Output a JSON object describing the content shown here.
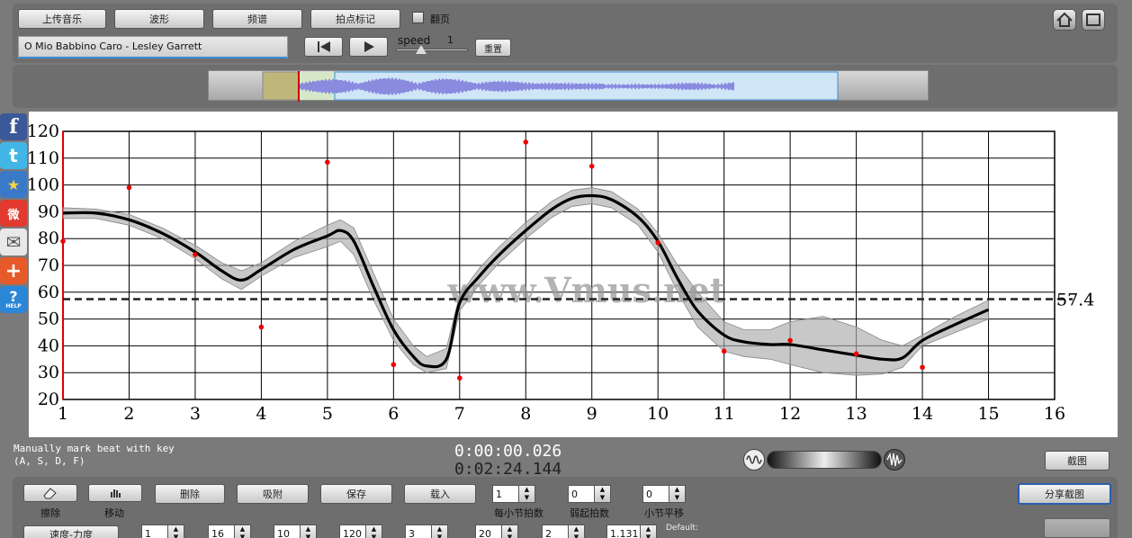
{
  "toolbar": {
    "upload": "上传音乐",
    "waveform": "波形",
    "spectrum": "频谱",
    "beat_mark": "拍点标记",
    "page_flip": "翻页",
    "song_title": "O Mio Babbino Caro - Lesley Garrett",
    "speed_label": "speed",
    "speed_value": "1",
    "reset": "重置"
  },
  "chart_data": {
    "type": "line",
    "x_ticks": [
      "1",
      "2",
      "3",
      "4",
      "5",
      "6",
      "7",
      "8",
      "9",
      "10",
      "11",
      "12",
      "13",
      "14",
      "15",
      "16"
    ],
    "y_ticks": [
      "20",
      "30",
      "40",
      "50",
      "60",
      "70",
      "80",
      "90",
      "100",
      "110",
      "120"
    ],
    "xlim": [
      1,
      16
    ],
    "ylim": [
      15,
      120
    ],
    "reference_line": {
      "value": 57.4,
      "label": "57.4"
    },
    "watermark": "www.Vmus.net",
    "smooth_curve": [
      [
        1,
        89.5
      ],
      [
        1.5,
        89.5
      ],
      [
        2,
        87
      ],
      [
        2.5,
        82
      ],
      [
        3,
        75
      ],
      [
        3.4,
        68
      ],
      [
        3.7,
        64.5
      ],
      [
        4,
        68.5
      ],
      [
        4.5,
        76
      ],
      [
        5,
        81
      ],
      [
        5.2,
        83
      ],
      [
        5.4,
        79
      ],
      [
        5.7,
        62
      ],
      [
        6,
        46
      ],
      [
        6.3,
        36
      ],
      [
        6.5,
        32.5
      ],
      [
        6.8,
        35
      ],
      [
        7,
        56
      ],
      [
        7.3,
        66
      ],
      [
        7.6,
        74
      ],
      [
        8,
        83
      ],
      [
        8.4,
        91
      ],
      [
        8.7,
        95
      ],
      [
        9,
        96
      ],
      [
        9.3,
        94.5
      ],
      [
        9.7,
        88
      ],
      [
        10,
        79
      ],
      [
        10.3,
        65
      ],
      [
        10.6,
        53
      ],
      [
        11,
        44
      ],
      [
        11.3,
        41.5
      ],
      [
        11.7,
        40.5
      ],
      [
        12,
        40.5
      ],
      [
        12.5,
        38.5
      ],
      [
        13,
        36.5
      ],
      [
        13.4,
        35
      ],
      [
        13.7,
        35.5
      ],
      [
        14,
        42
      ],
      [
        14.5,
        48
      ],
      [
        15,
        53.5
      ]
    ],
    "band_upper": [
      [
        1,
        91.5
      ],
      [
        1.5,
        91
      ],
      [
        2,
        89
      ],
      [
        2.5,
        84
      ],
      [
        3,
        77.5
      ],
      [
        3.4,
        71
      ],
      [
        3.7,
        68
      ],
      [
        4,
        71
      ],
      [
        4.5,
        79
      ],
      [
        5,
        85
      ],
      [
        5.2,
        87
      ],
      [
        5.4,
        84
      ],
      [
        5.7,
        67
      ],
      [
        6,
        50
      ],
      [
        6.3,
        40
      ],
      [
        6.5,
        36
      ],
      [
        6.8,
        39
      ],
      [
        7,
        59
      ],
      [
        7.3,
        69
      ],
      [
        7.6,
        77
      ],
      [
        8,
        86
      ],
      [
        8.4,
        94
      ],
      [
        8.7,
        98
      ],
      [
        9,
        99
      ],
      [
        9.3,
        97.5
      ],
      [
        9.7,
        91
      ],
      [
        10,
        82
      ],
      [
        10.3,
        70
      ],
      [
        10.6,
        60
      ],
      [
        11,
        49
      ],
      [
        11.3,
        46
      ],
      [
        11.7,
        46
      ],
      [
        12,
        49
      ],
      [
        12.5,
        51
      ],
      [
        13,
        47
      ],
      [
        13.4,
        42
      ],
      [
        13.7,
        40
      ],
      [
        14,
        44
      ],
      [
        14.5,
        51
      ],
      [
        15,
        57
      ]
    ],
    "band_lower": [
      [
        1,
        87.5
      ],
      [
        1.5,
        87.5
      ],
      [
        2,
        85
      ],
      [
        2.5,
        80
      ],
      [
        3,
        72.5
      ],
      [
        3.4,
        65
      ],
      [
        3.7,
        61
      ],
      [
        4,
        66
      ],
      [
        4.5,
        73
      ],
      [
        5,
        77
      ],
      [
        5.2,
        79
      ],
      [
        5.4,
        74
      ],
      [
        5.7,
        57
      ],
      [
        6,
        42
      ],
      [
        6.3,
        33
      ],
      [
        6.5,
        30
      ],
      [
        6.8,
        31.5
      ],
      [
        7,
        53
      ],
      [
        7.3,
        63
      ],
      [
        7.6,
        71
      ],
      [
        8,
        80
      ],
      [
        8.4,
        88
      ],
      [
        8.7,
        92
      ],
      [
        9,
        93
      ],
      [
        9.3,
        91.5
      ],
      [
        9.7,
        85
      ],
      [
        10,
        75
      ],
      [
        10.3,
        60
      ],
      [
        10.6,
        47
      ],
      [
        11,
        38
      ],
      [
        11.3,
        36
      ],
      [
        11.7,
        35
      ],
      [
        12,
        33
      ],
      [
        12.5,
        30
      ],
      [
        13,
        29
      ],
      [
        13.4,
        29.5
      ],
      [
        13.7,
        32
      ],
      [
        14,
        40
      ],
      [
        14.5,
        45
      ],
      [
        15,
        50
      ]
    ],
    "beat_points": [
      [
        1,
        79
      ],
      [
        2,
        99
      ],
      [
        3,
        74
      ],
      [
        4,
        47
      ],
      [
        5,
        108.5
      ],
      [
        6,
        33
      ],
      [
        7,
        28
      ],
      [
        8,
        116
      ],
      [
        9,
        107
      ],
      [
        10,
        78.5
      ],
      [
        11,
        38
      ],
      [
        12,
        42
      ],
      [
        13,
        37
      ],
      [
        14,
        32
      ]
    ]
  },
  "status": {
    "hint_line1": "Manually mark beat with key",
    "hint_line2": "(A, S, D, F)",
    "time_current": "0:00:00.026",
    "time_total": "0:02:24.144",
    "screenshot": "截图"
  },
  "bottom": {
    "erase": "擦除",
    "move": "移动",
    "delete": "删除",
    "snap": "吸附",
    "save": "保存",
    "load": "载入",
    "beats_per_bar_label": "每小节拍数",
    "beats_per_bar": "1",
    "pickup_label": "弱起拍数",
    "pickup": "0",
    "bar_shift_label": "小节平移",
    "bar_shift": "0",
    "share": "分享截图",
    "tempo_btn": "速度-力度",
    "row3_values": [
      "1",
      "16",
      "10",
      "120",
      "3",
      "20",
      "2",
      "1.131"
    ],
    "default_label": "Default:"
  },
  "social": {
    "facebook": "f",
    "twitter": "t",
    "star": "★",
    "weibo": "微",
    "mail": "✉",
    "plus": "+",
    "help": "?",
    "help_text": "HELP"
  }
}
